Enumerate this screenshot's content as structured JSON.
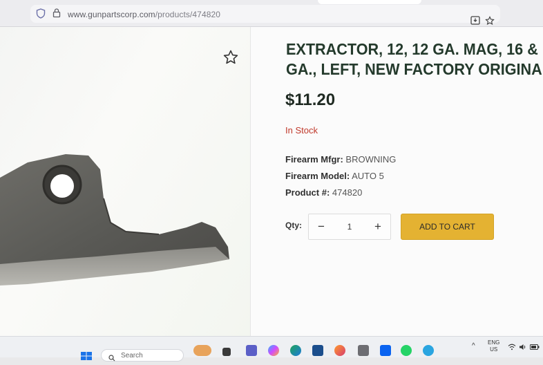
{
  "browser": {
    "url_host": "www.gunpartscorp.com",
    "url_path": "/products/474820"
  },
  "product": {
    "title_line1": "EXTRACTOR, 12, 12 GA. MAG, 16 &",
    "title_line2": "GA., LEFT, NEW FACTORY ORIGINA",
    "price": "$11.20",
    "stock": "In Stock",
    "specs": [
      {
        "label": "Firearm Mfgr:",
        "value": "BROWNING"
      },
      {
        "label": "Firearm Model:",
        "value": "AUTO 5"
      },
      {
        "label": "Product #:",
        "value": "474820"
      }
    ],
    "qty_label": "Qty:",
    "qty_value": "1",
    "minus_label": "−",
    "plus_label": "+",
    "add_to_cart": "ADD TO CART"
  },
  "taskbar": {
    "search_label": "Search",
    "lang_line1": "ENG",
    "lang_line2": "US",
    "apps": [
      "windows-icon",
      "search",
      "weather-icon",
      "file-explorer-icon",
      "teams-icon",
      "copilot-icon",
      "edge-icon",
      "store-icon",
      "firefox-icon",
      "calculator-icon",
      "dropbox-icon",
      "whatsapp-icon",
      "telegram-icon"
    ]
  },
  "colors": {
    "accent_button": "#e4b232",
    "title": "#243a2c",
    "stock": "#c0392b"
  }
}
